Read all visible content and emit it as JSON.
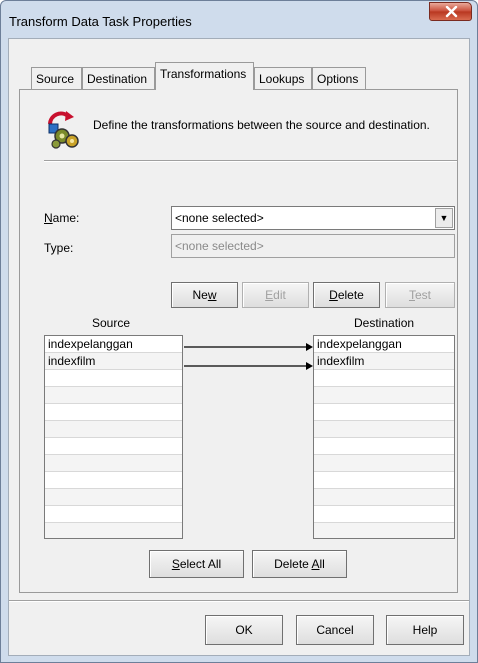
{
  "window": {
    "title": "Transform Data Task Properties"
  },
  "tabs": [
    {
      "label": "Source"
    },
    {
      "label": "Destination"
    },
    {
      "label": "Transformations"
    },
    {
      "label": "Lookups"
    },
    {
      "label": "Options"
    }
  ],
  "header": {
    "description": "Define the transformations between the source and destination."
  },
  "form": {
    "name_label_prefix": "N",
    "name_label_rest": "ame:",
    "name_value": "<none selected>",
    "type_label": "Type:",
    "type_value": "<none selected>"
  },
  "buttons": {
    "new_a": "Ne",
    "new_b": "w",
    "edit_a": "E",
    "edit_b": "dit",
    "delete_a": "D",
    "delete_b": "elete",
    "test_a": "T",
    "test_b": "est",
    "select_all_a": "S",
    "select_all_b": "elect All",
    "delete_all_a": "Delete ",
    "delete_all_b": "A",
    "delete_all_c": "ll",
    "ok": "OK",
    "cancel": "Cancel",
    "help": "Help"
  },
  "source": {
    "title": "Source",
    "columns": [
      "indexpelanggan",
      "indexfilm"
    ]
  },
  "destination": {
    "title": "Destination",
    "columns": [
      "indexpelanggan",
      "indexfilm"
    ]
  },
  "colors": {
    "title_bar": "#cfdcec",
    "close_button": "#c84a35",
    "dialog_bg": "#f0f0f0"
  }
}
